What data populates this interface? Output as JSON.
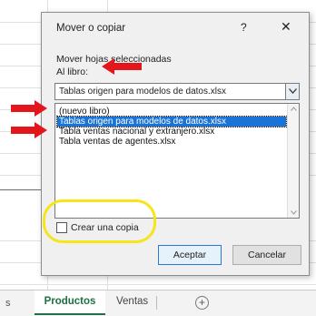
{
  "dialog": {
    "title": "Mover o copiar",
    "help_symbol": "?",
    "close_symbol": "✕",
    "move_label": "Mover hojas seleccionadas",
    "book_label": "Al libro:",
    "book_select_value": "Tablas origen para modelos de datos.xlsx",
    "book_list": [
      {
        "label": "(nuevo libro)",
        "selected": false
      },
      {
        "label": "Tablas origen para modelos de datos.xlsx",
        "selected": true
      },
      {
        "label": "Tabla ventas nacional y extranjero.xlsx",
        "selected": false
      },
      {
        "label": "Tabla ventas de agentes.xlsx",
        "selected": false
      }
    ],
    "copy_label": "Crear una copia",
    "copy_checked": false,
    "ok_label": "Aceptar",
    "cancel_label": "Cancelar"
  },
  "tabbar": {
    "dots": "s",
    "tabs": [
      "Productos",
      "Ventas"
    ],
    "active_tab": "Productos",
    "add_symbol": "+"
  },
  "colors": {
    "annotation_arrow": "#e3161b",
    "annotation_circle": "#f5e51a",
    "selection": "#1a73d6",
    "excel_green": "#1e7145"
  }
}
